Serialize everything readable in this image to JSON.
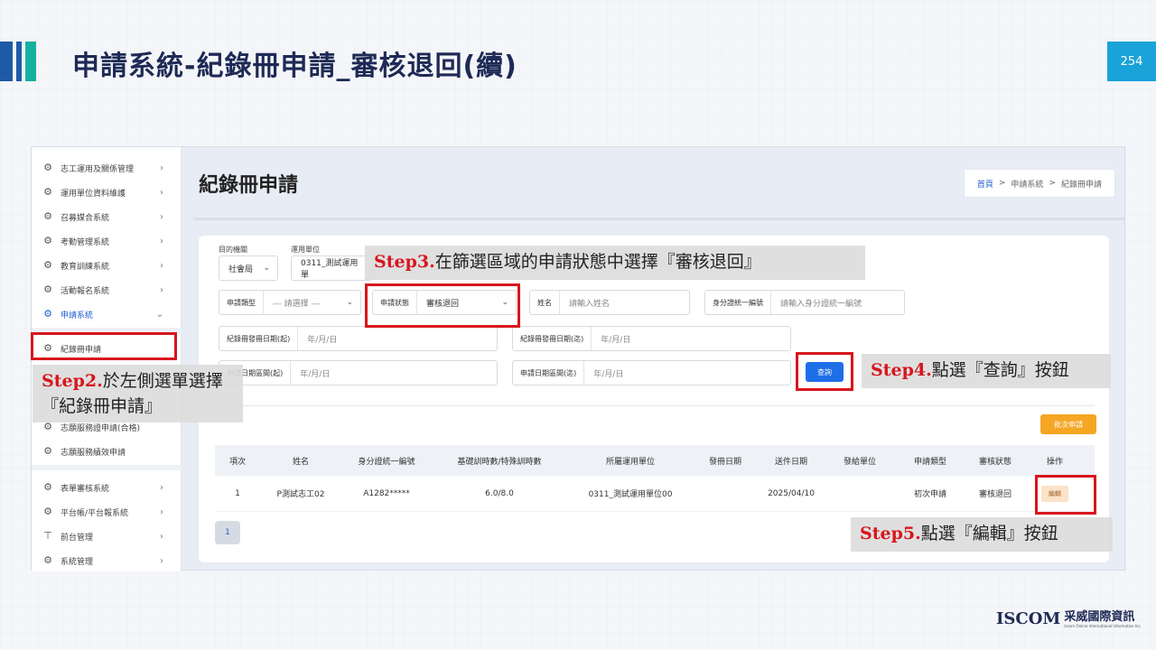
{
  "slide": {
    "title": "申請系統-紀錄冊申請_審核退回(續)",
    "page_number": "254"
  },
  "sidebar": {
    "items": [
      {
        "label": "志工運用及關係管理",
        "arrow": "›"
      },
      {
        "label": "運用單位資料維護",
        "arrow": "›"
      },
      {
        "label": "召募媒合系統",
        "arrow": "›"
      },
      {
        "label": "考勤管理系統",
        "arrow": "›"
      },
      {
        "label": "教育訓練系統",
        "arrow": "›"
      },
      {
        "label": "活動報名系統",
        "arrow": "›"
      },
      {
        "label": "申請系統",
        "arrow": "⌄"
      },
      {
        "label": "紀錄冊申請"
      },
      {
        "label": "志願服務證申請(合格)"
      },
      {
        "label": "志願服務績效申請"
      },
      {
        "label": "表單審核系統",
        "arrow": "›"
      },
      {
        "label": "平台帳/平台報系統",
        "arrow": "›"
      },
      {
        "label": "前台管理",
        "arrow": "›"
      },
      {
        "label": "系統管理",
        "arrow": "›"
      }
    ]
  },
  "main": {
    "page_title": "紀錄冊申請",
    "breadcrumb": {
      "home": "首頁",
      "sep": ">",
      "level1": "申請系統",
      "level2": "紀錄冊申請"
    }
  },
  "filters": {
    "dest_label": "目的機關",
    "dest_value": "社會局",
    "unit_label": "運用單位",
    "unit_value": "0311_測試運用單",
    "apply_type_label": "申請類型",
    "apply_type_value": "--- 請選擇 ---",
    "status_label": "申請狀態",
    "status_value": "審核退回",
    "name_label": "姓名",
    "name_placeholder": "請輸入姓名",
    "id_label": "身分證統一編號",
    "id_placeholder": "請輸入身分證統一編號",
    "issue_start_label": "紀錄冊發冊日期(起)",
    "issue_start_value": "年/月/日",
    "issue_end_label": "紀錄冊發冊日期(迄)",
    "issue_end_value": "年/月/日",
    "apply_start_label": "申請日期區間(起)",
    "apply_start_value": "年/月/日",
    "apply_end_label": "申請日期區間(迄)",
    "apply_end_value": "年/月/日",
    "query_button": "查詢",
    "batch_button": "批次申請"
  },
  "table": {
    "headers": [
      "項次",
      "姓名",
      "身分證統一編號",
      "基礎訓時數/特殊訓時數",
      "所屬運用單位",
      "發冊日期",
      "送件日期",
      "發給單位",
      "申請類型",
      "審核狀態",
      "操作"
    ],
    "rows": [
      [
        "1",
        "P測試志工02",
        "A1282*****",
        "6.0/8.0",
        "0311_測試運用單位00",
        "",
        "2025/04/10",
        "",
        "初次申請",
        "審核退回",
        "編輯"
      ]
    ],
    "page": "1"
  },
  "callouts": {
    "step2_tag": "Step2.",
    "step2_text": "於左側選單選擇『紀錄冊申請』",
    "step3_tag": "Step3.",
    "step3_text": "在篩選區域的申請狀態中選擇『審核退回』",
    "step4_tag": "Step4.",
    "step4_text": "點選『查詢』按鈕",
    "step5_tag": "Step5.",
    "step5_text": "點選『編輯』按鈕"
  },
  "logo": {
    "brand": "ISCOM",
    "cn": "采威國際資訊",
    "sub": "Iscom Online International Information Inc."
  },
  "colors": {
    "highlight": "#d8151d",
    "primary": "#1e6ee8",
    "batch": "#f5a623",
    "title": "#1e2a55",
    "accent": "#1aa3d8"
  }
}
